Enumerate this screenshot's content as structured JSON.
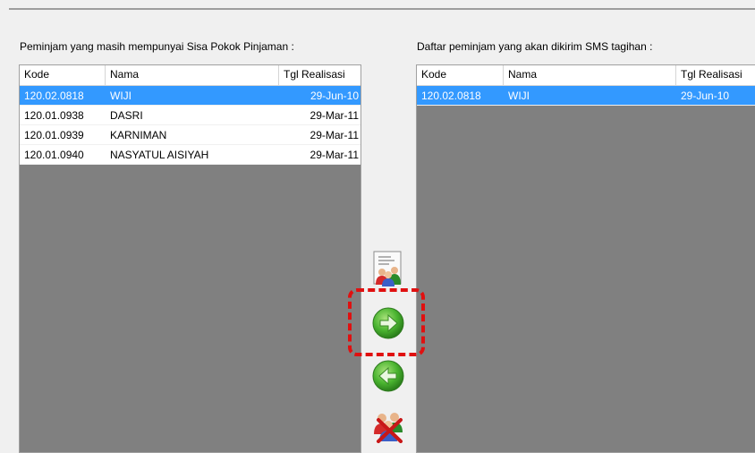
{
  "left_panel": {
    "label": "Peminjam yang masih mempunyai Sisa Pokok Pinjaman :",
    "columns": [
      "Kode",
      "Nama",
      "Tgl Realisasi"
    ],
    "rows": [
      {
        "kode": "120.02.0818",
        "nama": "WIJI",
        "tgl": "29-Jun-10",
        "selected": true
      },
      {
        "kode": "120.01.0938",
        "nama": "DASRI",
        "tgl": "29-Mar-11",
        "selected": false
      },
      {
        "kode": "120.01.0939",
        "nama": "KARNIMAN",
        "tgl": "29-Mar-11",
        "selected": false
      },
      {
        "kode": "120.01.0940",
        "nama": "NASYATUL AISIYAH",
        "tgl": "29-Mar-11",
        "selected": false
      }
    ]
  },
  "right_panel": {
    "label": "Daftar peminjam yang akan dikirim SMS tagihan :",
    "columns": [
      "Kode",
      "Nama",
      "Tgl Realisasi"
    ],
    "rows": [
      {
        "kode": "120.02.0818",
        "nama": "WIJI",
        "tgl": "29-Jun-10",
        "selected": true
      }
    ]
  },
  "buttons": {
    "add_all": {
      "icon": "users-list-icon"
    },
    "move_right": {
      "icon": "arrow-right-icon"
    },
    "move_left": {
      "icon": "arrow-left-icon"
    },
    "remove_all": {
      "icon": "users-remove-icon"
    }
  },
  "colors": {
    "selection": "#3399ff",
    "list_bg": "#808080",
    "highlight": "#e01010",
    "arrow_green": "#3fae2a"
  }
}
